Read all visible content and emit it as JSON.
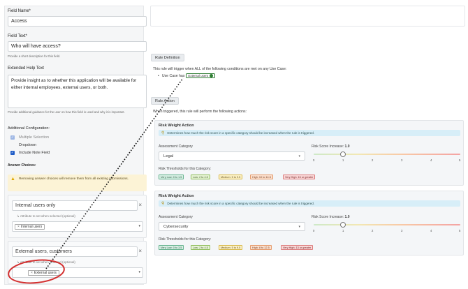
{
  "left": {
    "field_name_label": "Field Name*",
    "field_name_value": "Access",
    "field_text_label": "Field Text*",
    "field_text_value": "Who will have access?",
    "field_text_hint": "Provide a short description for this field.",
    "extended_help_label": "Extended Help Text",
    "extended_help_value": "Provide insight as to whether this application will be available for either internal employees, external users, or both.",
    "extended_help_hint": "Provide additional guidance for the user on how this field is used and why it is important.",
    "additional_config_label": "Additional Configuration:",
    "config_options": [
      {
        "label": "Multiple Selection",
        "state": "dim"
      },
      {
        "label": "Dropdown",
        "state": "empty"
      },
      {
        "label": "Include Note Field",
        "state": "checked"
      }
    ],
    "answer_choices_label": "Answer Choices:",
    "warning_text": "Removing answer choices will remove them from all existing submissions.",
    "choices": [
      {
        "value": "Internal users only",
        "attribute_hint": "Attribute to set when selected (optional)",
        "tag": "Internal users"
      },
      {
        "value": "External users, customers",
        "attribute_hint": "Attribute to set when selected (optional)",
        "tag": "External users"
      }
    ]
  },
  "right": {
    "rule_definition_label": "Rule Definition",
    "rule_trigger_text": "This rule will trigger when ALL of the following conditions are met on any Use Case:",
    "condition_prefix": "Use Case has",
    "condition_pill": "External users",
    "rule_action_label": "Rule Action",
    "rule_action_text": "When triggered, this rule will perform the following actions:",
    "cards": [
      {
        "title": "Risk Weight Action",
        "info": "Determines how much the risk score in a specific category should be increased when the rule is triggered.",
        "category_label": "Assessment Category",
        "category_value": "Legal",
        "increase_label": "Risk Score Increase:",
        "increase_value": "1.0",
        "increase_level": 1.0,
        "ticks": [
          "0",
          "1",
          "2",
          "3",
          "4",
          "5"
        ],
        "thresholds_label": "Risk Thresholds for this Category:",
        "thresholds": [
          {
            "label": "Very Low: 0 to 1.5",
            "cls": "t-vl"
          },
          {
            "label": "Low: 2 to 4.5",
            "cls": "t-l"
          },
          {
            "label": "Medium: 5 to 9.5",
            "cls": "t-m"
          },
          {
            "label": "High: 10 to 14.5",
            "cls": "t-h"
          },
          {
            "label": "Very High: 15 or greater",
            "cls": "t-vh"
          }
        ]
      },
      {
        "title": "Risk Weight Action",
        "info": "Determines how much the risk score in a specific category should be increased when the rule is triggered.",
        "category_label": "Assessment Category",
        "category_value": "Cybersecurity",
        "increase_label": "Risk Score Increase:",
        "increase_value": "1.0",
        "increase_level": 1.0,
        "ticks": [
          "0",
          "1",
          "2",
          "3",
          "4",
          "5"
        ],
        "thresholds_label": "Risk Thresholds for this Category:",
        "thresholds": [
          {
            "label": "Very Low: 0 to 3.5",
            "cls": "t-vl"
          },
          {
            "label": "Low: 2 to 4.5",
            "cls": "t-l"
          },
          {
            "label": "Medium: 5 to 9.5",
            "cls": "t-m"
          },
          {
            "label": "High: 8 to 12.5",
            "cls": "t-h"
          },
          {
            "label": "Very High: 13 or greater",
            "cls": "t-vh"
          }
        ]
      }
    ]
  },
  "colors": {
    "accent": "#1f5cc7",
    "annotation": "#d32f2f",
    "connector": "#111111"
  }
}
